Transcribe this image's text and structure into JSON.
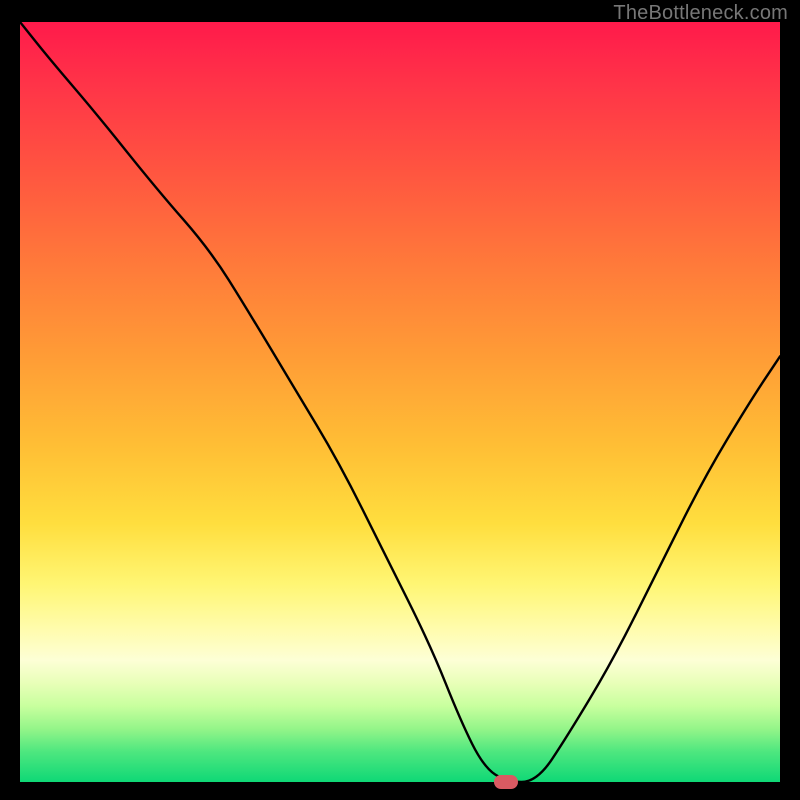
{
  "watermark": "TheBottleneck.com",
  "chart_data": {
    "type": "line",
    "title": "",
    "xlabel": "",
    "ylabel": "",
    "xlim": [
      0,
      100
    ],
    "ylim": [
      0,
      100
    ],
    "grid": false,
    "legend": false,
    "series": [
      {
        "name": "bottleneck-curve",
        "x": [
          0,
          4,
          10,
          18,
          25,
          30,
          36,
          42,
          48,
          54,
          58,
          61,
          64,
          68,
          72,
          78,
          84,
          90,
          96,
          100
        ],
        "values": [
          100,
          95,
          88,
          78,
          70,
          62,
          52,
          42,
          30,
          18,
          8,
          2,
          0,
          0,
          6,
          16,
          28,
          40,
          50,
          56
        ]
      }
    ],
    "marker": {
      "x": 64,
      "y": 0
    },
    "background_gradient": {
      "top": "#ff1a4b",
      "mid": "#ffde3e",
      "bottom": "#0fd876"
    }
  }
}
